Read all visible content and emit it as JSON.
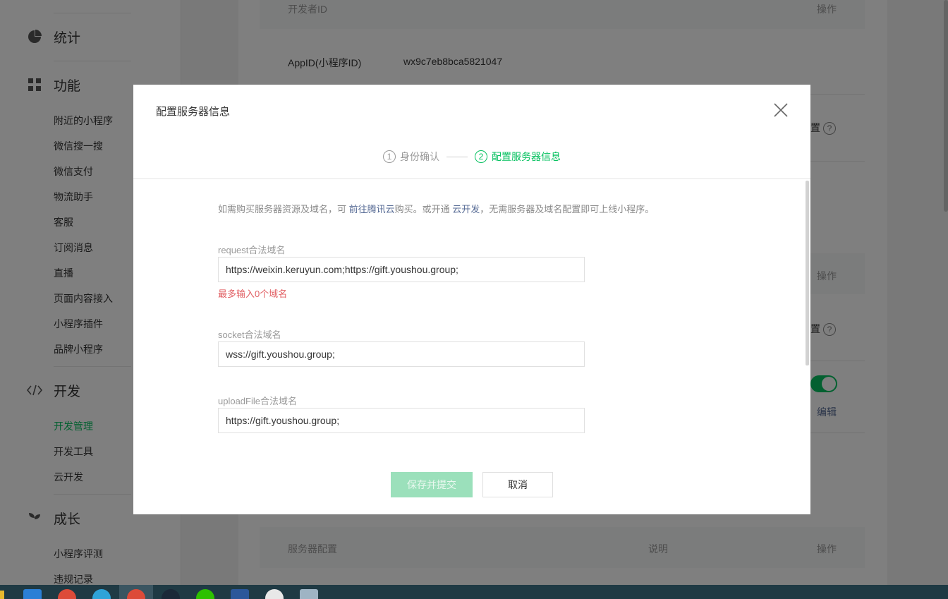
{
  "sidebar": {
    "groups": {
      "stats": "统计",
      "features": "功能",
      "dev": "开发",
      "growth": "成长"
    },
    "feature_items": [
      "附近的小程序",
      "微信搜一搜",
      "微信支付",
      "物流助手",
      "客服",
      "订阅消息",
      "直播",
      "页面内容接入",
      "小程序插件",
      "品牌小程序"
    ],
    "dev_items": [
      "开发管理",
      "开发工具",
      "云开发"
    ],
    "growth_items": [
      "小程序评测",
      "违规记录"
    ],
    "active_item": "开发管理",
    "accent_color": "#07c160"
  },
  "background": {
    "dev_id_header": "开发者ID",
    "action_header": "操作",
    "appid_label": "AppID(小程序ID)",
    "appid_value": "wx9c7eb8bca5821047",
    "partial_config_1": "置",
    "partial_config_2": "置",
    "action_header_2": "操作",
    "edit_link": "编辑",
    "server_config_header": "服务器配置",
    "desc_header": "说明",
    "action_header_3": "操作"
  },
  "modal": {
    "title": "配置服务器信息",
    "steps": [
      {
        "num": "1",
        "label": "身份确认"
      },
      {
        "num": "2",
        "label": "配置服务器信息"
      }
    ],
    "notice": {
      "part1": "如需购买服务器资源及域名，可 ",
      "link1": "前往腾讯云",
      "part2": "购买。或开通 ",
      "link2": "云开发",
      "part3": "，无需服务器及域名配置即可上线小程序。"
    },
    "request": {
      "label": "request合法域名",
      "value": "https://weixin.keruyun.com;https://gift.youshou.group;",
      "error": "最多输入0个域名"
    },
    "socket": {
      "label": "socket合法域名",
      "value": "wss://gift.youshou.group;"
    },
    "upload": {
      "label": "uploadFile合法域名",
      "value": "https://gift.youshou.group;"
    },
    "save_button": "保存并提交",
    "cancel_button": "取消"
  }
}
